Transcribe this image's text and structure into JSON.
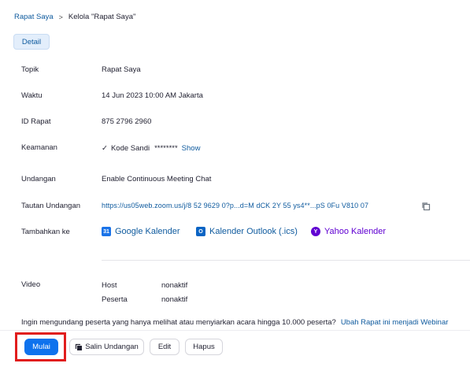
{
  "breadcrumb": {
    "parent": "Rapat Saya",
    "separator": ">",
    "current": "Kelola \"Rapat Saya\""
  },
  "tabs": {
    "detail": "Detail"
  },
  "fields": {
    "topic": {
      "label": "Topik",
      "value": "Rapat Saya"
    },
    "time": {
      "label": "Waktu",
      "value": "14 Jun 2023 10:00 AM Jakarta"
    },
    "meeting_id": {
      "label": "ID Rapat",
      "value": "875 2796 2960"
    },
    "security": {
      "label": "Keamanan",
      "check": "✓",
      "passcode_label": "Kode Sandi",
      "passcode_mask": "********",
      "show": "Show"
    },
    "invitees": {
      "label": "Undangan",
      "value": "Enable Continuous Meeting Chat"
    },
    "invite_link": {
      "label": "Tautan Undangan",
      "value": "https://us05web.zoom.us/j/8 52 9629 0?p...d=M dCK 2Y 55 ys4**...pS 0Fu V810 07"
    },
    "add_to": {
      "label": "Tambahkan ke",
      "google": {
        "icon": "google-calendar-icon",
        "glyph": "31",
        "text": "Google Kalender"
      },
      "outlook": {
        "icon": "outlook-icon",
        "glyph": "O",
        "text": "Kalender Outlook (.ics)"
      },
      "yahoo": {
        "icon": "yahoo-icon",
        "glyph": "Y",
        "text": "Yahoo Kalender"
      }
    },
    "video": {
      "label": "Video",
      "host_label": "Host",
      "host_value": "nonaktif",
      "participant_label": "Peserta",
      "participant_value": "nonaktif"
    }
  },
  "webinar": {
    "question": "Ingin mengundang peserta yang hanya melihat atau menyiarkan acara hingga 10.000 peserta?",
    "link": "Ubah Rapat ini menjadi Webinar"
  },
  "actions": {
    "start": "Mulai",
    "copy_invite": "Salin Undangan",
    "edit": "Edit",
    "delete": "Hapus"
  },
  "colors": {
    "primary": "#0e72ed",
    "link": "#0e5a9e",
    "highlight": "#e11d1d",
    "yahoo": "#6001d2"
  }
}
